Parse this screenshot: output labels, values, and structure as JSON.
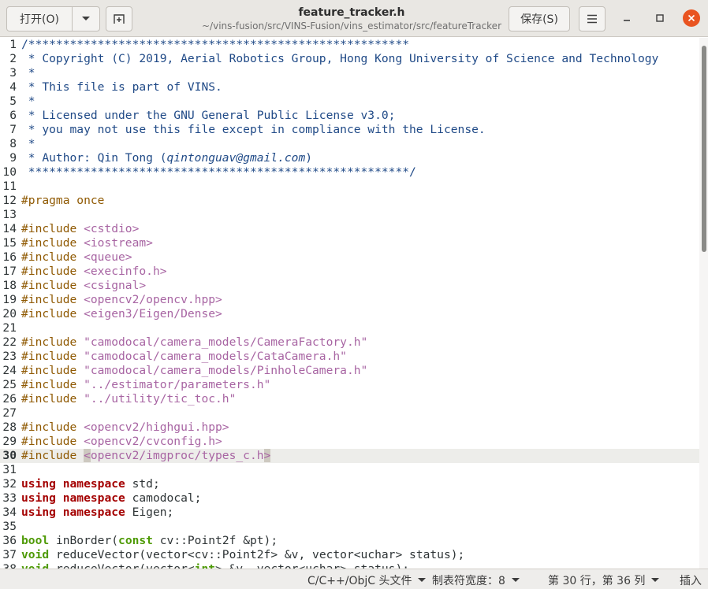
{
  "header": {
    "open_label": "打开(O)",
    "title": "feature_tracker.h",
    "path": "~/vins-fusion/src/VINS-Fusion/vins_estimator/src/featureTracker",
    "save_label": "保存(S)"
  },
  "icons": {
    "open_dropdown": "chevron-down-icon",
    "new_tab": "new-tab-icon",
    "menu": "hamburger-menu-icon",
    "minimize": "minimize-icon",
    "maximize": "maximize-icon",
    "close": "close-icon"
  },
  "colors": {
    "close_button": "#e95420",
    "comment": "#204a87",
    "preprocessor": "#8f5902",
    "string": "#a865a3",
    "keyword": "#a40000",
    "type": "#4e9a06"
  },
  "editor": {
    "current_line": 30,
    "lines": [
      {
        "n": "1",
        "tokens": [
          [
            "com",
            "/*******************************************************"
          ]
        ]
      },
      {
        "n": "2",
        "tokens": [
          [
            "com",
            " * Copyright (C) 2019, Aerial Robotics Group, Hong Kong University of Science and Technology"
          ]
        ]
      },
      {
        "n": "3",
        "tokens": [
          [
            "com",
            " *"
          ]
        ]
      },
      {
        "n": "4",
        "tokens": [
          [
            "com",
            " * This file is part of VINS."
          ]
        ]
      },
      {
        "n": "5",
        "tokens": [
          [
            "com",
            " *"
          ]
        ]
      },
      {
        "n": "6",
        "tokens": [
          [
            "com",
            " * Licensed under the GNU General Public License v3.0;"
          ]
        ]
      },
      {
        "n": "7",
        "tokens": [
          [
            "com",
            " * you may not use this file except in compliance with the License."
          ]
        ]
      },
      {
        "n": "8",
        "tokens": [
          [
            "com",
            " *"
          ]
        ]
      },
      {
        "n": "9",
        "tokens": [
          [
            "com",
            " * Author: Qin Tong ("
          ],
          [
            "em",
            "qintonguav@gmail.com"
          ],
          [
            "com",
            ")"
          ]
        ]
      },
      {
        "n": "10",
        "tokens": [
          [
            "com",
            " *******************************************************/"
          ]
        ]
      },
      {
        "n": "11",
        "tokens": []
      },
      {
        "n": "12",
        "tokens": [
          [
            "pre",
            "#pragma once"
          ]
        ]
      },
      {
        "n": "13",
        "tokens": []
      },
      {
        "n": "14",
        "tokens": [
          [
            "pre",
            "#include "
          ],
          [
            "str",
            "<cstdio>"
          ]
        ]
      },
      {
        "n": "15",
        "tokens": [
          [
            "pre",
            "#include "
          ],
          [
            "str",
            "<iostream>"
          ]
        ]
      },
      {
        "n": "16",
        "tokens": [
          [
            "pre",
            "#include "
          ],
          [
            "str",
            "<queue>"
          ]
        ]
      },
      {
        "n": "17",
        "tokens": [
          [
            "pre",
            "#include "
          ],
          [
            "str",
            "<execinfo.h>"
          ]
        ]
      },
      {
        "n": "18",
        "tokens": [
          [
            "pre",
            "#include "
          ],
          [
            "str",
            "<csignal>"
          ]
        ]
      },
      {
        "n": "19",
        "tokens": [
          [
            "pre",
            "#include "
          ],
          [
            "str",
            "<opencv2/opencv.hpp>"
          ]
        ]
      },
      {
        "n": "20",
        "tokens": [
          [
            "pre",
            "#include "
          ],
          [
            "str",
            "<eigen3/Eigen/Dense>"
          ]
        ]
      },
      {
        "n": "21",
        "tokens": []
      },
      {
        "n": "22",
        "tokens": [
          [
            "pre",
            "#include "
          ],
          [
            "str",
            "\"camodocal/camera_models/CameraFactory.h\""
          ]
        ]
      },
      {
        "n": "23",
        "tokens": [
          [
            "pre",
            "#include "
          ],
          [
            "str",
            "\"camodocal/camera_models/CataCamera.h\""
          ]
        ]
      },
      {
        "n": "24",
        "tokens": [
          [
            "pre",
            "#include "
          ],
          [
            "str",
            "\"camodocal/camera_models/PinholeCamera.h\""
          ]
        ]
      },
      {
        "n": "25",
        "tokens": [
          [
            "pre",
            "#include "
          ],
          [
            "str",
            "\"../estimator/parameters.h\""
          ]
        ]
      },
      {
        "n": "26",
        "tokens": [
          [
            "pre",
            "#include "
          ],
          [
            "str",
            "\"../utility/tic_toc.h\""
          ]
        ]
      },
      {
        "n": "27",
        "tokens": []
      },
      {
        "n": "28",
        "tokens": [
          [
            "pre",
            "#include "
          ],
          [
            "str",
            "<opencv2/highgui.hpp>"
          ]
        ]
      },
      {
        "n": "29",
        "tokens": [
          [
            "pre",
            "#include "
          ],
          [
            "str",
            "<opencv2/cvconfig.h>"
          ]
        ]
      },
      {
        "n": "30",
        "tokens": [
          [
            "pre",
            "#include "
          ],
          [
            "strhl",
            "<"
          ],
          [
            "str",
            "opencv2/imgproc/types_c.h"
          ],
          [
            "strhl",
            ">"
          ]
        ]
      },
      {
        "n": "31",
        "tokens": []
      },
      {
        "n": "32",
        "tokens": [
          [
            "kw",
            "using"
          ],
          [
            "pl",
            " "
          ],
          [
            "kw",
            "namespace"
          ],
          [
            "pl",
            " std;"
          ]
        ]
      },
      {
        "n": "33",
        "tokens": [
          [
            "kw",
            "using"
          ],
          [
            "pl",
            " "
          ],
          [
            "kw",
            "namespace"
          ],
          [
            "pl",
            " camodocal;"
          ]
        ]
      },
      {
        "n": "34",
        "tokens": [
          [
            "kw",
            "using"
          ],
          [
            "pl",
            " "
          ],
          [
            "kw",
            "namespace"
          ],
          [
            "pl",
            " Eigen;"
          ]
        ]
      },
      {
        "n": "35",
        "tokens": []
      },
      {
        "n": "36",
        "tokens": [
          [
            "type",
            "bool"
          ],
          [
            "pl",
            " inBorder("
          ],
          [
            "type",
            "const"
          ],
          [
            "pl",
            " cv::Point2f &pt);"
          ]
        ]
      },
      {
        "n": "37",
        "tokens": [
          [
            "type",
            "void"
          ],
          [
            "pl",
            " reduceVector(vector<cv::Point2f> &v, vector<uchar> status);"
          ]
        ]
      },
      {
        "n": "38",
        "tokens": [
          [
            "type",
            "void"
          ],
          [
            "pl",
            " reduceVector(vector<"
          ],
          [
            "type",
            "int"
          ],
          [
            "pl",
            "> &v, vector<uchar> status);"
          ]
        ]
      }
    ]
  },
  "status_bar": {
    "language": "C/C++/ObjC 头文件",
    "tab_width": "制表符宽度：8",
    "position": "第 30 行，第 36 列",
    "mode": "插入"
  }
}
